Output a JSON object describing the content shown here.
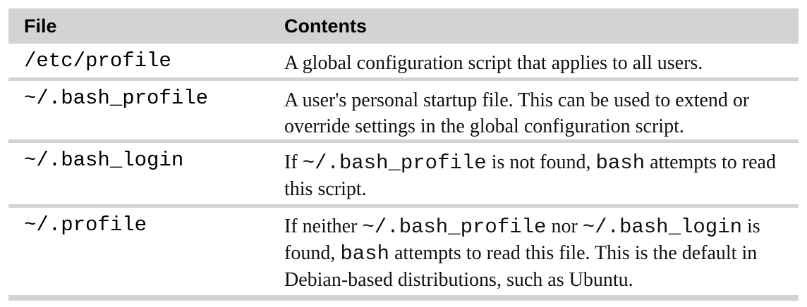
{
  "table": {
    "headers": {
      "file": "File",
      "contents": "Contents"
    },
    "rows": [
      {
        "file": "/etc/profile",
        "desc": [
          {
            "text": "A global configuration script that applies to all users."
          }
        ]
      },
      {
        "file": "~/.bash_profile",
        "desc": [
          {
            "text": "A user's personal startup file. This can be used to extend or override settings in the global configuration script."
          }
        ]
      },
      {
        "file": "~/.bash_login",
        "desc": [
          {
            "text": "If "
          },
          {
            "text": "~/.bash_profile",
            "mono": true
          },
          {
            "text": " is not found, "
          },
          {
            "text": "bash",
            "mono": true
          },
          {
            "text": " attempts to read this script."
          }
        ]
      },
      {
        "file": "~/.profile",
        "desc": [
          {
            "text": "If neither "
          },
          {
            "text": "~/.bash_profile",
            "mono": true
          },
          {
            "text": " nor "
          },
          {
            "text": "~/.bash_login",
            "mono": true
          },
          {
            "text": " is found, "
          },
          {
            "text": "bash",
            "mono": true
          },
          {
            "text": " attempts to read this file. This is the default in Debian-based distributions, such as Ubuntu."
          }
        ]
      }
    ]
  },
  "colors": {
    "header_background": "#d3d3d3",
    "separator": "#d3d3d3"
  }
}
